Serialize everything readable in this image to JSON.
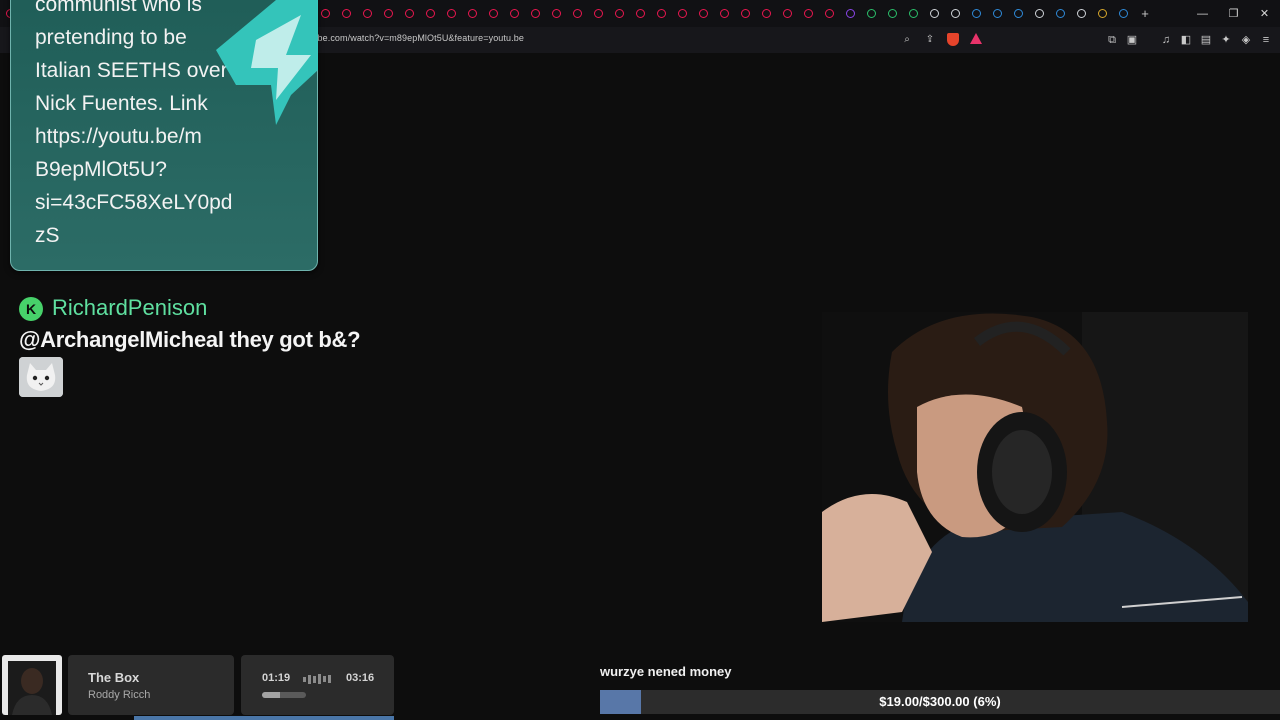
{
  "browser": {
    "url": "youtube.com/watch?v=m89epMlOt5U&feature=youtu.be",
    "tabs": [
      "yt",
      "yt",
      "yt",
      "yt",
      "yt",
      "yt",
      "yt",
      "yt",
      "yt",
      "yt",
      "yt",
      "yt",
      "yt",
      "yt",
      "yt",
      "yt",
      "yt",
      "yt",
      "yt",
      "yt",
      "yt",
      "yt",
      "yt",
      "yt",
      "yt",
      "yt",
      "yt",
      "yt",
      "yt",
      "yt",
      "yt",
      "yt",
      "yt",
      "yt",
      "yt",
      "yt",
      "yt",
      "yt",
      "yt",
      "yt",
      "tw",
      "gr",
      "gr",
      "gr",
      "wh",
      "wh",
      "bl",
      "bl",
      "bl",
      "wh",
      "bl",
      "wh",
      "or",
      "bl"
    ],
    "new_tab_label": "+",
    "colors": {
      "tab_bar": "#111114",
      "address_bar": "#17171b",
      "youtube_red": "#e8174f"
    }
  },
  "chat": {
    "highlighted_message": {
      "lines": [
        "communist who is",
        "pretending to be",
        "Italian SEETHS over",
        "Nick Fuentes. Link",
        "https://youtu.be/m",
        "B9epMlOt5U?",
        "si=43cFC58XeLY0pd",
        "zS"
      ]
    },
    "message": {
      "badge_letter": "K",
      "username": "RichardPenison",
      "text": "@ArchangelMicheal they got b&?",
      "emote": "cat-emote"
    },
    "colors": {
      "bubble": "#245f5a",
      "username": "#5fe0a0",
      "badge": "#47d16a"
    }
  },
  "music": {
    "title": "The Box",
    "artist": "Roddy Ricch",
    "current_time": "01:19",
    "duration": "03:16",
    "progress": 0.4
  },
  "donation_goal": {
    "label": "wurzye nened money",
    "progress_text": "$19.00/$300.00 (6%)",
    "progress": 0.06,
    "color": "#5877a8"
  }
}
